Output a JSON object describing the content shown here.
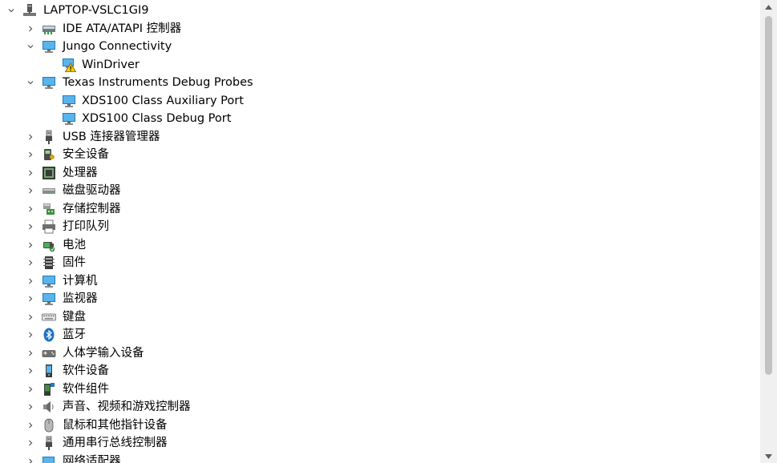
{
  "colors": {
    "selection": "#e5f1fb",
    "scrollbar_track": "#f0f0f0",
    "scrollbar_thumb": "#c2c2c2"
  },
  "tree": {
    "rows": [
      {
        "label": "LAPTOP-VSLC1GI9",
        "level": 0,
        "chevron": "down",
        "icon": "computer-root-icon"
      },
      {
        "label": "IDE ATA/ATAPI 控制器",
        "level": 1,
        "chevron": "right",
        "icon": "ide-controller-icon"
      },
      {
        "label": "Jungo Connectivity",
        "level": 1,
        "chevron": "down",
        "icon": "monitor-icon"
      },
      {
        "label": "WinDriver",
        "level": 2,
        "chevron": "none",
        "icon": "warning-device-icon"
      },
      {
        "label": "Texas Instruments Debug Probes",
        "level": 1,
        "chevron": "down",
        "icon": "monitor-icon"
      },
      {
        "label": "XDS100 Class Auxiliary Port",
        "level": 2,
        "chevron": "none",
        "icon": "monitor-icon"
      },
      {
        "label": "XDS100 Class Debug Port",
        "level": 2,
        "chevron": "none",
        "icon": "monitor-icon"
      },
      {
        "label": "USB 连接器管理器",
        "level": 1,
        "chevron": "right",
        "icon": "usb-icon"
      },
      {
        "label": "安全设备",
        "level": 1,
        "chevron": "right",
        "icon": "security-icon"
      },
      {
        "label": "处理器",
        "level": 1,
        "chevron": "right",
        "icon": "processor-icon"
      },
      {
        "label": "磁盘驱动器",
        "level": 1,
        "chevron": "right",
        "icon": "disk-icon"
      },
      {
        "label": "存储控制器",
        "level": 1,
        "chevron": "right",
        "icon": "storage-controller-icon"
      },
      {
        "label": "打印队列",
        "level": 1,
        "chevron": "right",
        "icon": "printer-icon"
      },
      {
        "label": "电池",
        "level": 1,
        "chevron": "right",
        "icon": "battery-icon"
      },
      {
        "label": "固件",
        "level": 1,
        "chevron": "right",
        "icon": "firmware-icon"
      },
      {
        "label": "计算机",
        "level": 1,
        "chevron": "right",
        "icon": "monitor-icon"
      },
      {
        "label": "监视器",
        "level": 1,
        "chevron": "right",
        "icon": "monitor-icon"
      },
      {
        "label": "键盘",
        "level": 1,
        "chevron": "right",
        "icon": "keyboard-icon"
      },
      {
        "label": "蓝牙",
        "level": 1,
        "chevron": "right",
        "icon": "bluetooth-icon"
      },
      {
        "label": "人体学输入设备",
        "level": 1,
        "chevron": "right",
        "icon": "hid-icon"
      },
      {
        "label": "软件设备",
        "level": 1,
        "chevron": "right",
        "icon": "software-device-icon"
      },
      {
        "label": "软件组件",
        "level": 1,
        "chevron": "right",
        "icon": "software-component-icon"
      },
      {
        "label": "声音、视频和游戏控制器",
        "level": 1,
        "chevron": "right",
        "icon": "speaker-icon"
      },
      {
        "label": "鼠标和其他指针设备",
        "level": 1,
        "chevron": "right",
        "icon": "mouse-icon"
      },
      {
        "label": "通用串行总线控制器",
        "level": 1,
        "chevron": "right",
        "icon": "usb-icon"
      },
      {
        "label": "网络适配器",
        "level": 1,
        "chevron": "right",
        "icon": "network-adapter-icon"
      }
    ]
  }
}
